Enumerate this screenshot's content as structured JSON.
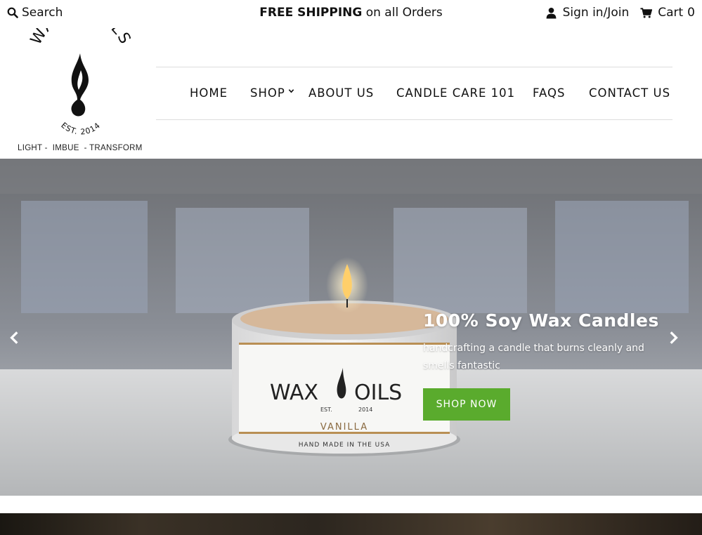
{
  "topbar": {
    "search_label": "Search",
    "promo_bold": "FREE SHIPPING",
    "promo_rest": " on all Orders",
    "signin_label": "Sign in/Join",
    "cart_label": "Cart",
    "cart_count": "0"
  },
  "logo": {
    "brand_text": "WAX & OILS",
    "established": "EST. 2014",
    "tagline": "LIGHT -  IMBUE  - TRANSFORM"
  },
  "nav": {
    "items": [
      {
        "label": "HOME"
      },
      {
        "label": "SHOP"
      },
      {
        "label": "ABOUT US"
      },
      {
        "label": "CANDLE CARE 101"
      },
      {
        "label": "FAQS"
      },
      {
        "label": "CONTACT US"
      }
    ]
  },
  "hero": {
    "title": "100% Soy Wax Candles",
    "subtitle": "handcrafting a candle that burns cleanly and smells fantastic",
    "button_label": "SHOP NOW",
    "candle_brand": "WAX OILS",
    "candle_est": "EST.",
    "candle_year": "2014",
    "candle_scent": "VANILLA",
    "candle_note": "HAND MADE IN THE USA"
  },
  "colors": {
    "accent": "#5aab2d",
    "text": "#111111",
    "divider": "#dddddd"
  },
  "icons": [
    "search-icon",
    "user-icon",
    "cart-icon",
    "chevron-down-icon",
    "chevron-left-icon",
    "chevron-right-icon"
  ]
}
